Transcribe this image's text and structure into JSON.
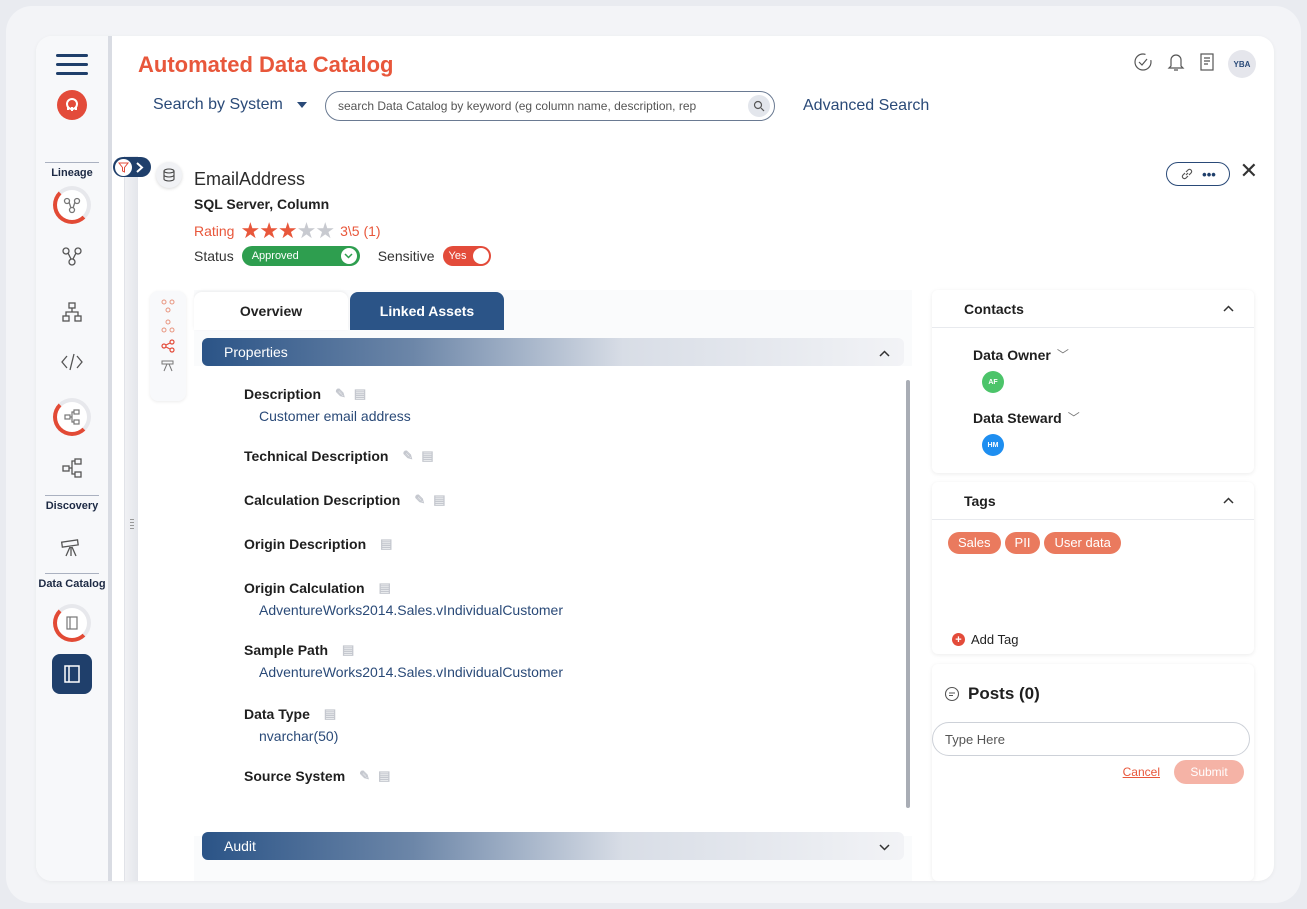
{
  "app": {
    "title": "Automated Data Catalog"
  },
  "header": {
    "system_select": "Search by System",
    "search_placeholder": "search Data Catalog by keyword (eg column name, description, rep",
    "advanced_search": "Advanced Search",
    "avatar": "YBA"
  },
  "sidebar": {
    "sections": [
      "Lineage",
      "Discovery",
      "Data Catalog"
    ]
  },
  "asset": {
    "name": "EmailAddress",
    "type": "SQL Server, Column",
    "rating_label": "Rating",
    "rating_value": 3,
    "rating_max": 5,
    "rating_text": "3\\5 (1)",
    "status_label": "Status",
    "status_value": "Approved",
    "sensitive_label": "Sensitive",
    "sensitive_value": "Yes"
  },
  "tabs": [
    {
      "label": "Overview",
      "active": true
    },
    {
      "label": "Linked Assets",
      "active": false
    }
  ],
  "sections": {
    "properties": "Properties",
    "audit": "Audit"
  },
  "properties": [
    {
      "label": "Description",
      "value": "Customer email address"
    },
    {
      "label": "Technical Description",
      "value": ""
    },
    {
      "label": "Calculation Description",
      "value": ""
    },
    {
      "label": "Origin Description",
      "value": ""
    },
    {
      "label": "Origin Calculation",
      "value": "AdventureWorks2014.Sales.vIndividualCustomer"
    },
    {
      "label": "Sample Path",
      "value": "AdventureWorks2014.Sales.vIndividualCustomer"
    },
    {
      "label": "Data Type",
      "value": "nvarchar(50)"
    },
    {
      "label": "Source System",
      "value": ""
    }
  ],
  "contacts": {
    "title": "Contacts",
    "owner_label": "Data Owner",
    "owner_initials": "AF",
    "steward_label": "Data Steward",
    "steward_initials": "HM"
  },
  "tags": {
    "title": "Tags",
    "items": [
      "Sales",
      "PII",
      "User data"
    ],
    "add_label": "Add Tag"
  },
  "posts": {
    "title": "Posts (0)",
    "placeholder": "Type Here",
    "cancel": "Cancel",
    "submit": "Submit"
  },
  "colors": {
    "brand": "#e8573b",
    "navy": "#1f3f6b",
    "approved": "#2e9e4f",
    "sensitive": "#e34b3a",
    "tag": "#ea7a5e",
    "owner_avatar": "#4cc46a",
    "steward_avatar": "#1e8ef0"
  }
}
